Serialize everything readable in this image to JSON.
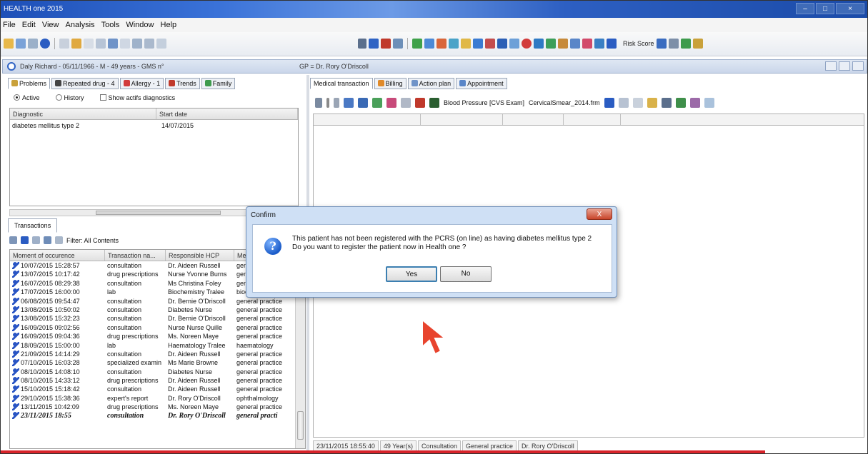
{
  "app": {
    "title": "HEALTH one 2015"
  },
  "window_buttons": [
    "–",
    "□",
    "×"
  ],
  "menu": [
    "File",
    "Edit",
    "View",
    "Analysis",
    "Tools",
    "Window",
    "Help"
  ],
  "toolbar": {
    "risk_score_label": "Risk Score"
  },
  "patient": {
    "header": "Daly Richard - 05/11/1966 - M - 49 years - GMS n°"
  },
  "gp": {
    "label": "GP = Dr. Rory O'Driscoll"
  },
  "left_tabs": [
    {
      "label": "Problems",
      "icon": "problems-icon"
    },
    {
      "label": "Repeated drug - 4",
      "icon": "drug-icon"
    },
    {
      "label": "Allergy - 1",
      "icon": "allergy-icon"
    },
    {
      "label": "Trends",
      "icon": "trends-icon"
    },
    {
      "label": "Family",
      "icon": "family-icon"
    }
  ],
  "filters": {
    "active": "Active",
    "history": "History",
    "show_actifs": "Show actifs diagnostics"
  },
  "problems_grid": {
    "headers": [
      "Diagnostic",
      "Start date"
    ],
    "rows": [
      {
        "diagnostic": "diabetes mellitus type 2",
        "start_date": "14/07/2015"
      }
    ]
  },
  "transactions": {
    "tab": "Transactions",
    "filter_label": "Filter: All Contents",
    "headers": [
      "Moment of occurence",
      "Transaction na...",
      "Responsible HCP",
      "Me"
    ],
    "rows": [
      [
        "10/07/2015 15:28:57",
        "consultation",
        "Dr. Aideen Russell",
        "gene"
      ],
      [
        "13/07/2015 10:17:42",
        "drug prescriptions",
        "Nurse Yvonne Burns",
        "gene"
      ],
      [
        "16/07/2015 08:29:38",
        "consultation",
        "Ms Christina Foley",
        "gene"
      ],
      [
        "17/07/2015 16:00:00",
        "lab",
        "Biochemistry Tralee",
        "bioc"
      ],
      [
        "06/08/2015 09:54:47",
        "consultation",
        "Dr. Bernie O'Driscoll",
        "general practice"
      ],
      [
        "13/08/2015 10:50:02",
        "consultation",
        "Diabetes Nurse",
        "general practice"
      ],
      [
        "13/08/2015 15:32:23",
        "consultation",
        "Dr. Bernie O'Driscoll",
        "general practice"
      ],
      [
        "16/09/2015 09:02:56",
        "consultation",
        "Nurse Nurse Quille",
        "general practice"
      ],
      [
        "16/09/2015 09:04:36",
        "drug prescriptions",
        "Ms. Noreen Maye",
        "general practice"
      ],
      [
        "18/09/2015 15:00:00",
        "lab",
        "Haematology Tralee",
        "haematology"
      ],
      [
        "21/09/2015 14:14:29",
        "consultation",
        "Dr. Aideen Russell",
        "general practice"
      ],
      [
        "07/10/2015 16:03:28",
        "specialized examin",
        "Ms Marie Browne",
        "general practice"
      ],
      [
        "08/10/2015 14:08:10",
        "consultation",
        "Diabetes Nurse",
        "general practice"
      ],
      [
        "08/10/2015 14:33:12",
        "drug prescriptions",
        "Dr. Aideen Russell",
        "general practice"
      ],
      [
        "15/10/2015 15:18:42",
        "consultation",
        "Dr. Aideen Russell",
        "general practice"
      ],
      [
        "29/10/2015 15:38:36",
        "expert's report",
        "Dr. Rory O'Driscoll",
        "ophthalmology"
      ],
      [
        "13/11/2015 10:42:09",
        "drug prescriptions",
        "Ms. Noreen Maye",
        "general practice"
      ],
      [
        "23/11/2015 18:55",
        "consultation",
        "Dr. Rory O'Driscoll",
        "general practi"
      ]
    ]
  },
  "right_tabs": [
    {
      "label": "Medical transaction",
      "icon": ""
    },
    {
      "label": "Billing",
      "icon": "billing-icon"
    },
    {
      "label": "Action plan",
      "icon": "action-plan-icon"
    },
    {
      "label": "Appointment",
      "icon": "appointment-icon"
    }
  ],
  "right_toolbar": {
    "bp_label": "Blood Pressure [CVS Exam]",
    "file_label": "CervicalSmear_2014.frm"
  },
  "status_bar": [
    "23/11/2015 18:55:40",
    "49 Year(s)",
    "Consultation",
    "General practice",
    "Dr. Rory O'Driscoll"
  ],
  "dialog": {
    "title": "Confirm",
    "close": "X",
    "line1": "This patient has not been registered with the PCRS (on line) as having diabetes mellitus type 2",
    "line2": "Do you want to register the patient now in Health one ?",
    "yes": "Yes",
    "no": "No"
  },
  "colors": {
    "accent": "#2f63c4",
    "alert_bar": "#d8232a"
  }
}
